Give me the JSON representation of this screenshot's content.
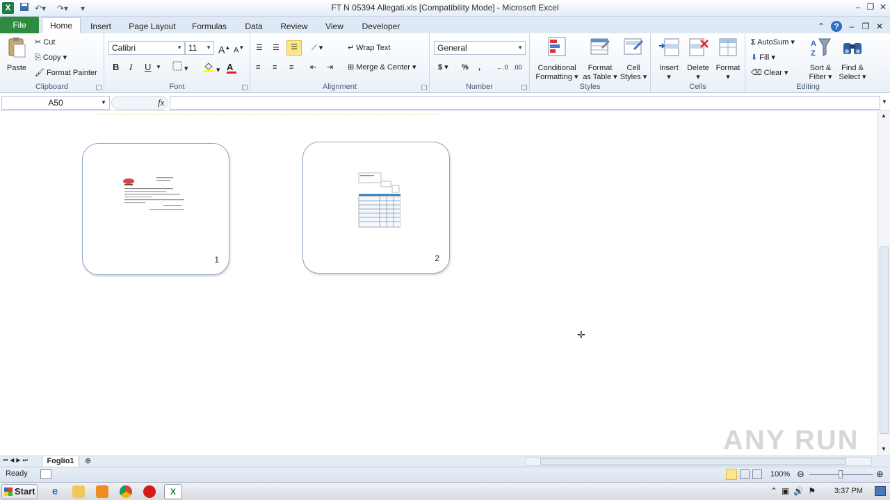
{
  "window": {
    "title": "FT N 05394 Allegati.xls  [Compatibility Mode]  -  Microsoft Excel"
  },
  "ribbon_tabs": [
    "File",
    "Home",
    "Insert",
    "Page Layout",
    "Formulas",
    "Data",
    "Review",
    "View",
    "Developer"
  ],
  "clipboard": {
    "paste": "Paste",
    "cut": "Cut",
    "copy": "Copy",
    "format_painter": "Format Painter",
    "label": "Clipboard"
  },
  "font": {
    "name": "Calibri",
    "size": "11",
    "label": "Font",
    "bold": "B",
    "italic": "I",
    "underline": "U"
  },
  "alignment": {
    "wrap_text": "Wrap Text",
    "merge_center": "Merge & Center",
    "label": "Alignment"
  },
  "number": {
    "format": "General",
    "currency": "$",
    "percent": "%",
    "comma": ",",
    "label": "Number"
  },
  "styles": {
    "conditional_l1": "Conditional",
    "conditional_l2": "Formatting",
    "format_table_l1": "Format",
    "format_table_l2": "as Table",
    "cell_styles_l1": "Cell",
    "cell_styles_l2": "Styles",
    "label": "Styles"
  },
  "cells": {
    "insert": "Insert",
    "delete": "Delete",
    "format": "Format",
    "label": "Cells"
  },
  "editing": {
    "autosum": "AutoSum",
    "fill": "Fill",
    "clear": "Clear",
    "sort_l1": "Sort &",
    "sort_l2": "Filter",
    "find_l1": "Find &",
    "find_l2": "Select",
    "label": "Editing"
  },
  "formula_bar": {
    "name_box": "A50",
    "fx": "fx",
    "formula": ""
  },
  "thumbnails": [
    {
      "number": "1"
    },
    {
      "number": "2"
    }
  ],
  "sheet_tab": "Foglio1",
  "status": {
    "ready": "Ready",
    "zoom": "100%"
  },
  "taskbar": {
    "start": "Start",
    "clock": "3:37 PM"
  },
  "watermark": "ANY RUN",
  "colors": {
    "excel_green": "#1f7a3f",
    "file_tab": "#2e8b3f",
    "card_border": "#8fa7c8"
  }
}
